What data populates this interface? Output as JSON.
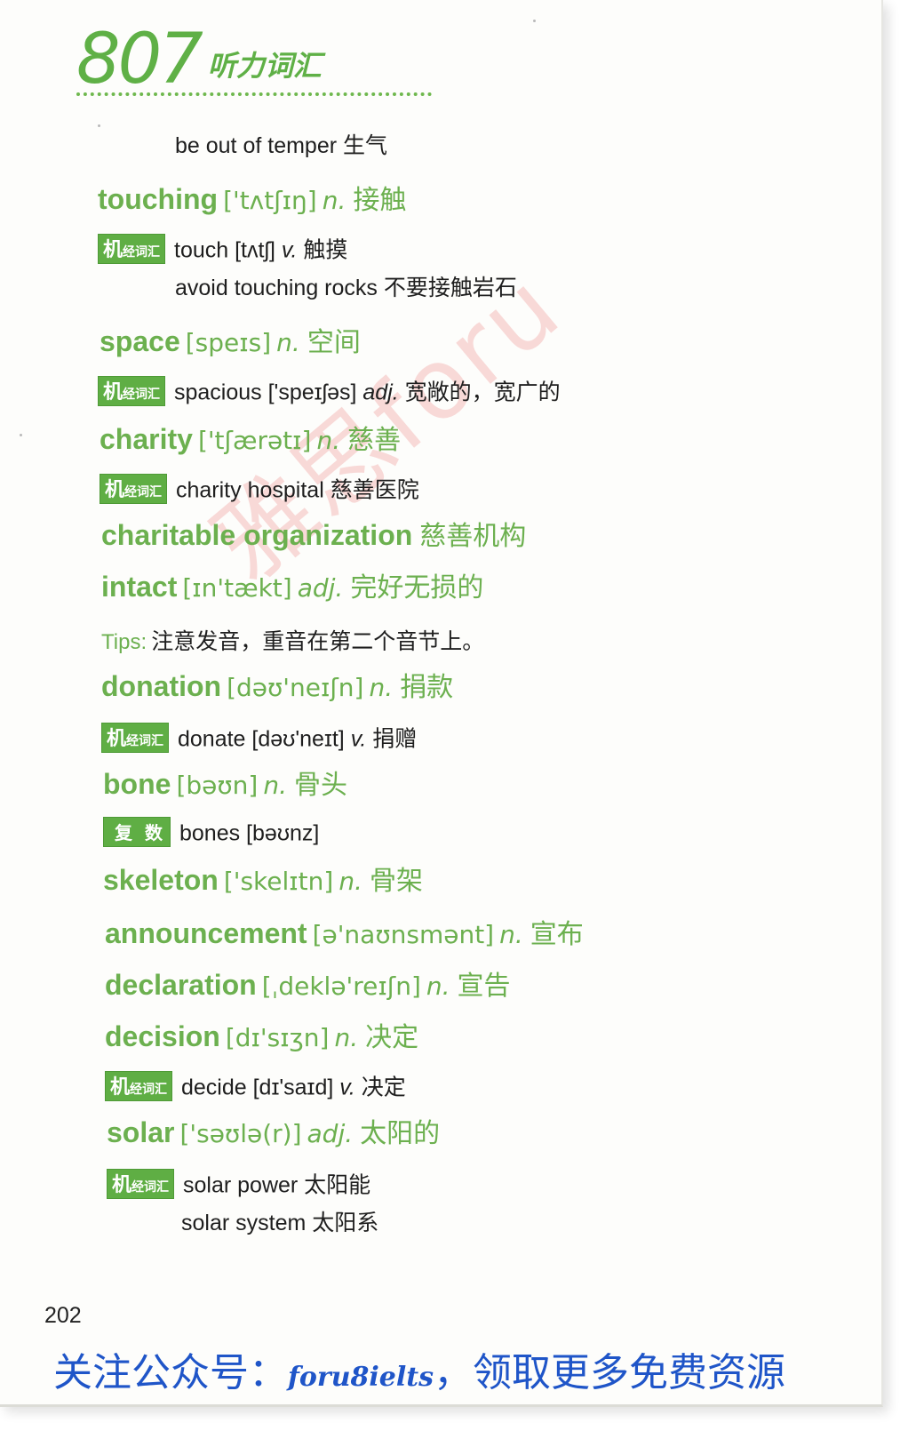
{
  "header": {
    "number": "807",
    "title": "听力词汇"
  },
  "watermark": "雅思foru",
  "tags": {
    "jijing": {
      "big": "机",
      "small": "经词汇"
    },
    "plural": "复数"
  },
  "entries": {
    "be_out_of_temper": "be out of temper 生气",
    "touching": {
      "word": "touching",
      "phon": "['tʌtʃɪŋ]",
      "pos": "n.",
      "mean": "接触"
    },
    "touch": {
      "main": "touch [tʌtʃ] ",
      "pos": "v.",
      "mean": " 触摸"
    },
    "avoid_touching": "avoid touching rocks 不要接触岩石",
    "space": {
      "word": "space",
      "phon": "[speɪs]",
      "pos": "n.",
      "mean": "空间"
    },
    "spacious": {
      "main": "spacious ['speɪʃəs] ",
      "pos": "adj.",
      "mean": " 宽敞的，宽广的"
    },
    "charity": {
      "word": "charity",
      "phon": "['tʃærətɪ]",
      "pos": "n.",
      "mean": "慈善"
    },
    "charity_hospital": "charity hospital 慈善医院",
    "charitable": {
      "word": "charitable organization",
      "mean": "慈善机构"
    },
    "intact": {
      "word": "intact",
      "phon": "[ɪn'tækt]",
      "pos": "adj.",
      "mean": "完好无损的"
    },
    "tips": {
      "label": "Tips:",
      "text": "注意发音，重音在第二个音节上。"
    },
    "donation": {
      "word": "donation",
      "phon": "[dəʊ'neɪʃn]",
      "pos": "n.",
      "mean": "捐款"
    },
    "donate": {
      "main": "donate [dəʊ'neɪt] ",
      "pos": "v.",
      "mean": " 捐赠"
    },
    "bone": {
      "word": "bone",
      "phon": "[bəʊn]",
      "pos": "n.",
      "mean": "骨头"
    },
    "bones": "bones [bəʊnz]",
    "skeleton": {
      "word": "skeleton",
      "phon": "['skelɪtn]",
      "pos": "n.",
      "mean": "骨架"
    },
    "announcement": {
      "word": "announcement",
      "phon": "[ə'naʊnsmənt]",
      "pos": "n.",
      "mean": "宣布"
    },
    "declaration": {
      "word": "declaration",
      "phon": "[ˌdeklə'reɪʃn]",
      "pos": "n.",
      "mean": "宣告"
    },
    "decision": {
      "word": "decision",
      "phon": "[dɪ'sɪʒn]",
      "pos": "n.",
      "mean": "决定"
    },
    "decide": {
      "main": "decide [dɪ'saɪd] ",
      "pos": "v.",
      "mean": " 决定"
    },
    "solar": {
      "word": "solar",
      "phon": "['səʊlə(r)]",
      "pos": "adj.",
      "mean": "太阳的"
    },
    "solar_power": "solar power 太阳能",
    "solar_system": "solar system 太阳系"
  },
  "page_number": "202",
  "footer": {
    "prefix": "关注公众号：",
    "account": "foru8ielts",
    "suffix": "，领取更多免费资源"
  }
}
